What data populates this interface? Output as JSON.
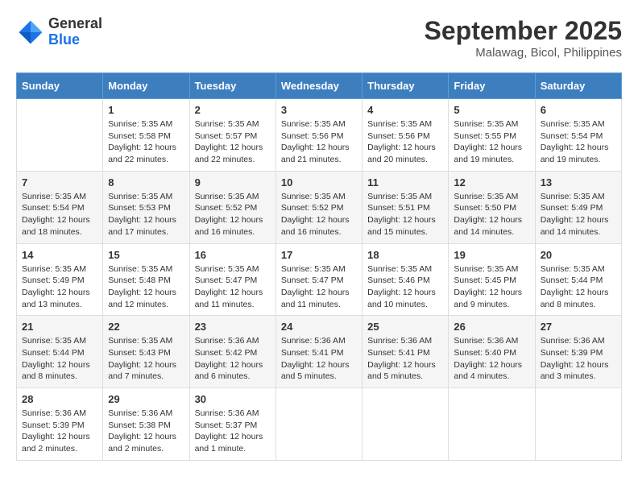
{
  "header": {
    "logo_general": "General",
    "logo_blue": "Blue",
    "month_title": "September 2025",
    "location": "Malawag, Bicol, Philippines"
  },
  "days_of_week": [
    "Sunday",
    "Monday",
    "Tuesday",
    "Wednesday",
    "Thursday",
    "Friday",
    "Saturday"
  ],
  "weeks": [
    [
      {
        "day": "",
        "sunrise": "",
        "sunset": "",
        "daylight": ""
      },
      {
        "day": "1",
        "sunrise": "Sunrise: 5:35 AM",
        "sunset": "Sunset: 5:58 PM",
        "daylight": "Daylight: 12 hours and 22 minutes."
      },
      {
        "day": "2",
        "sunrise": "Sunrise: 5:35 AM",
        "sunset": "Sunset: 5:57 PM",
        "daylight": "Daylight: 12 hours and 22 minutes."
      },
      {
        "day": "3",
        "sunrise": "Sunrise: 5:35 AM",
        "sunset": "Sunset: 5:56 PM",
        "daylight": "Daylight: 12 hours and 21 minutes."
      },
      {
        "day": "4",
        "sunrise": "Sunrise: 5:35 AM",
        "sunset": "Sunset: 5:56 PM",
        "daylight": "Daylight: 12 hours and 20 minutes."
      },
      {
        "day": "5",
        "sunrise": "Sunrise: 5:35 AM",
        "sunset": "Sunset: 5:55 PM",
        "daylight": "Daylight: 12 hours and 19 minutes."
      },
      {
        "day": "6",
        "sunrise": "Sunrise: 5:35 AM",
        "sunset": "Sunset: 5:54 PM",
        "daylight": "Daylight: 12 hours and 19 minutes."
      }
    ],
    [
      {
        "day": "7",
        "sunrise": "Sunrise: 5:35 AM",
        "sunset": "Sunset: 5:54 PM",
        "daylight": "Daylight: 12 hours and 18 minutes."
      },
      {
        "day": "8",
        "sunrise": "Sunrise: 5:35 AM",
        "sunset": "Sunset: 5:53 PM",
        "daylight": "Daylight: 12 hours and 17 minutes."
      },
      {
        "day": "9",
        "sunrise": "Sunrise: 5:35 AM",
        "sunset": "Sunset: 5:52 PM",
        "daylight": "Daylight: 12 hours and 16 minutes."
      },
      {
        "day": "10",
        "sunrise": "Sunrise: 5:35 AM",
        "sunset": "Sunset: 5:52 PM",
        "daylight": "Daylight: 12 hours and 16 minutes."
      },
      {
        "day": "11",
        "sunrise": "Sunrise: 5:35 AM",
        "sunset": "Sunset: 5:51 PM",
        "daylight": "Daylight: 12 hours and 15 minutes."
      },
      {
        "day": "12",
        "sunrise": "Sunrise: 5:35 AM",
        "sunset": "Sunset: 5:50 PM",
        "daylight": "Daylight: 12 hours and 14 minutes."
      },
      {
        "day": "13",
        "sunrise": "Sunrise: 5:35 AM",
        "sunset": "Sunset: 5:49 PM",
        "daylight": "Daylight: 12 hours and 14 minutes."
      }
    ],
    [
      {
        "day": "14",
        "sunrise": "Sunrise: 5:35 AM",
        "sunset": "Sunset: 5:49 PM",
        "daylight": "Daylight: 12 hours and 13 minutes."
      },
      {
        "day": "15",
        "sunrise": "Sunrise: 5:35 AM",
        "sunset": "Sunset: 5:48 PM",
        "daylight": "Daylight: 12 hours and 12 minutes."
      },
      {
        "day": "16",
        "sunrise": "Sunrise: 5:35 AM",
        "sunset": "Sunset: 5:47 PM",
        "daylight": "Daylight: 12 hours and 11 minutes."
      },
      {
        "day": "17",
        "sunrise": "Sunrise: 5:35 AM",
        "sunset": "Sunset: 5:47 PM",
        "daylight": "Daylight: 12 hours and 11 minutes."
      },
      {
        "day": "18",
        "sunrise": "Sunrise: 5:35 AM",
        "sunset": "Sunset: 5:46 PM",
        "daylight": "Daylight: 12 hours and 10 minutes."
      },
      {
        "day": "19",
        "sunrise": "Sunrise: 5:35 AM",
        "sunset": "Sunset: 5:45 PM",
        "daylight": "Daylight: 12 hours and 9 minutes."
      },
      {
        "day": "20",
        "sunrise": "Sunrise: 5:35 AM",
        "sunset": "Sunset: 5:44 PM",
        "daylight": "Daylight: 12 hours and 8 minutes."
      }
    ],
    [
      {
        "day": "21",
        "sunrise": "Sunrise: 5:35 AM",
        "sunset": "Sunset: 5:44 PM",
        "daylight": "Daylight: 12 hours and 8 minutes."
      },
      {
        "day": "22",
        "sunrise": "Sunrise: 5:35 AM",
        "sunset": "Sunset: 5:43 PM",
        "daylight": "Daylight: 12 hours and 7 minutes."
      },
      {
        "day": "23",
        "sunrise": "Sunrise: 5:36 AM",
        "sunset": "Sunset: 5:42 PM",
        "daylight": "Daylight: 12 hours and 6 minutes."
      },
      {
        "day": "24",
        "sunrise": "Sunrise: 5:36 AM",
        "sunset": "Sunset: 5:41 PM",
        "daylight": "Daylight: 12 hours and 5 minutes."
      },
      {
        "day": "25",
        "sunrise": "Sunrise: 5:36 AM",
        "sunset": "Sunset: 5:41 PM",
        "daylight": "Daylight: 12 hours and 5 minutes."
      },
      {
        "day": "26",
        "sunrise": "Sunrise: 5:36 AM",
        "sunset": "Sunset: 5:40 PM",
        "daylight": "Daylight: 12 hours and 4 minutes."
      },
      {
        "day": "27",
        "sunrise": "Sunrise: 5:36 AM",
        "sunset": "Sunset: 5:39 PM",
        "daylight": "Daylight: 12 hours and 3 minutes."
      }
    ],
    [
      {
        "day": "28",
        "sunrise": "Sunrise: 5:36 AM",
        "sunset": "Sunset: 5:39 PM",
        "daylight": "Daylight: 12 hours and 2 minutes."
      },
      {
        "day": "29",
        "sunrise": "Sunrise: 5:36 AM",
        "sunset": "Sunset: 5:38 PM",
        "daylight": "Daylight: 12 hours and 2 minutes."
      },
      {
        "day": "30",
        "sunrise": "Sunrise: 5:36 AM",
        "sunset": "Sunset: 5:37 PM",
        "daylight": "Daylight: 12 hours and 1 minute."
      },
      {
        "day": "",
        "sunrise": "",
        "sunset": "",
        "daylight": ""
      },
      {
        "day": "",
        "sunrise": "",
        "sunset": "",
        "daylight": ""
      },
      {
        "day": "",
        "sunrise": "",
        "sunset": "",
        "daylight": ""
      },
      {
        "day": "",
        "sunrise": "",
        "sunset": "",
        "daylight": ""
      }
    ]
  ]
}
